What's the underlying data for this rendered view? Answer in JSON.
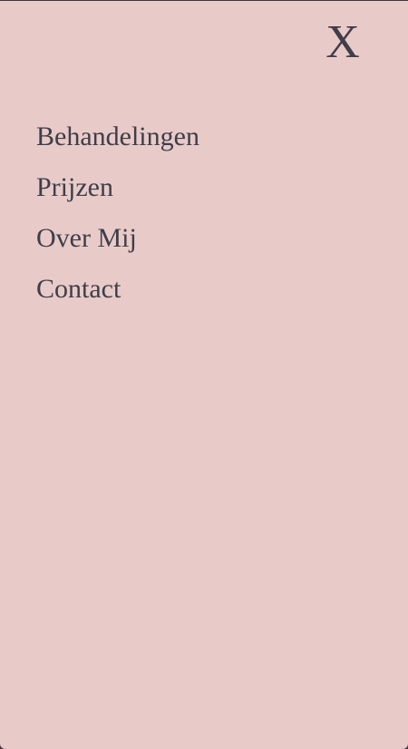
{
  "menu": {
    "close_label": "X",
    "items": [
      {
        "label": "Behandelingen"
      },
      {
        "label": "Prijzen"
      },
      {
        "label": "Over Mij"
      },
      {
        "label": "Contact"
      }
    ]
  },
  "colors": {
    "panel_background": "#e8cbc9",
    "text": "#3f3e49"
  }
}
